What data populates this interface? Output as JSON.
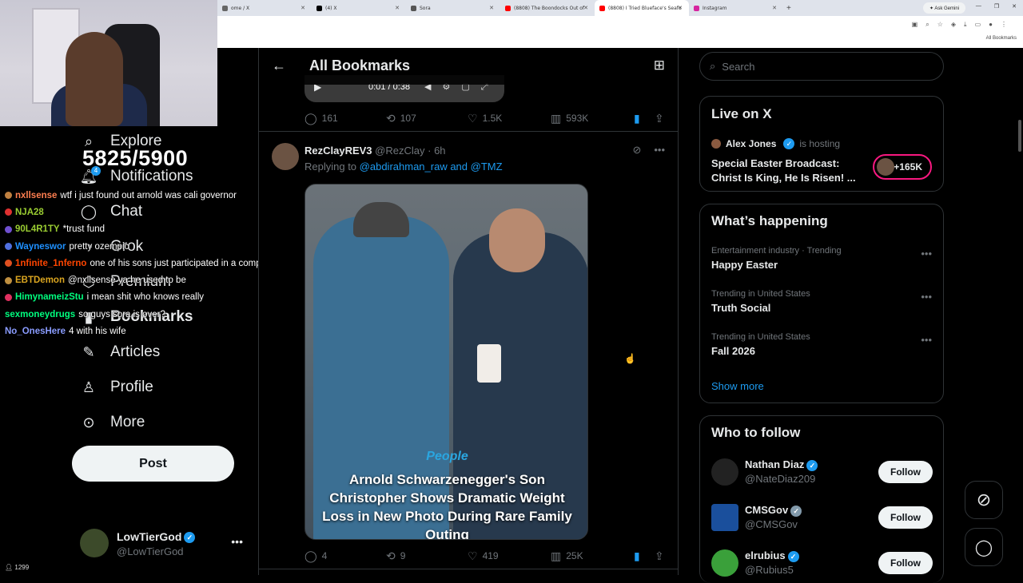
{
  "browser": {
    "tabs": [
      {
        "label": "ome / X",
        "color": "#666"
      },
      {
        "label": "(4) X",
        "color": "#000"
      },
      {
        "label": "Sora",
        "color": "#555"
      },
      {
        "label": "(8808) The Boondocks Out of",
        "color": "#ff0000"
      },
      {
        "label": "(8808) I Tried Blueface's Seafo",
        "color": "#ff0000"
      },
      {
        "label": "Instagram",
        "color": "#d6249f"
      }
    ],
    "new_tab": "+",
    "ask_gemini": "✦ Ask Gemini",
    "all_bookmarks": "All Bookmarks"
  },
  "stream": {
    "follower_count": "5825/5900",
    "viewers": "1299",
    "chat": [
      {
        "user": "nxllsense",
        "msg": "wtf i just found out arnold was cali governor",
        "color": "#ff7f50",
        "badge": "#c08040"
      },
      {
        "user": "NJA28",
        "msg": "",
        "color": "#9acd32",
        "badge": "#e03030"
      },
      {
        "user": "90L4R1TY",
        "msg": "*trust fund",
        "color": "#9acd32",
        "badge": "#7050d0"
      },
      {
        "user": "Wayneswor",
        "msg": "pretty ozempic",
        "color": "#1e90ff",
        "badge": "#5070e0"
      },
      {
        "user": "1nfinite_1nferno",
        "msg": "one of his sons just participated in a competition",
        "color": "#ff4500",
        "badge": "#e05020"
      },
      {
        "user": "EBTDemon",
        "msg": "@nxllsense ya he used to be",
        "color": "#daa520",
        "badge": "#c09040"
      },
      {
        "user": "HimynameizStu",
        "msg": "i mean shit who knows really",
        "color": "#00ff7f",
        "badge": "#e03060"
      },
      {
        "user": "sexmoneydrugs",
        "msg": "so guys sora is over?",
        "color": "#00ff7f",
        "badge": ""
      },
      {
        "user": "No_OnesHere",
        "msg": "4 with his wife",
        "color": "#8a9cff",
        "badge": ""
      }
    ]
  },
  "nav": {
    "explore": "Explore",
    "notifications": "Notifications",
    "notif_count": "4",
    "chat": "Chat",
    "grok": "Grok",
    "premium": "Premium",
    "bookmarks": "Bookmarks",
    "articles": "Articles",
    "profile": "Profile",
    "more": "More",
    "post": "Post",
    "account_name": "LowTierGod",
    "account_handle": "@LowTierGod"
  },
  "main": {
    "title": "All Bookmarks",
    "video_time": "0:01 / 0:38",
    "tweet1_stats": {
      "replies": "161",
      "reposts": "107",
      "likes": "1.5K",
      "views": "593K"
    },
    "tweet2": {
      "name": "RezClayREV3",
      "handle": "@RezClay",
      "time": "· 6h",
      "replying_prefix": "Replying to",
      "replying_users": "@abdirahman_raw and @TMZ",
      "image_brand": "People",
      "image_caption": "Arnold Schwarzenegger's Son Christopher Shows Dramatic Weight Loss in New Photo During Rare Family Outing",
      "stats": {
        "replies": "4",
        "reposts": "9",
        "likes": "419",
        "views": "25K"
      }
    }
  },
  "sidebar": {
    "search_placeholder": "Search",
    "live": {
      "heading": "Live on X",
      "host": "Alex Jones",
      "is_hosting": "is hosting",
      "title": "Special Easter Broadcast: Christ Is King, He Is Risen! ...",
      "count": "+165K"
    },
    "happening": {
      "heading": "What’s happening",
      "trends": [
        {
          "context": "Entertainment industry · Trending",
          "title": "Happy Easter"
        },
        {
          "context": "Trending in United States",
          "title": "Truth Social"
        },
        {
          "context": "Trending in United States",
          "title": "Fall 2026"
        }
      ],
      "show_more": "Show more"
    },
    "who_to_follow": {
      "heading": "Who to follow",
      "follow_label": "Follow",
      "people": [
        {
          "name": "Nathan Diaz",
          "handle": "@NateDiaz209",
          "avatar": "#222"
        },
        {
          "name": "CMSGov",
          "handle": "@CMSGov",
          "avatar": "#1a4f9c"
        },
        {
          "name": "elrubius",
          "handle": "@Rubius5",
          "avatar": "#3aa03a"
        }
      ]
    }
  }
}
